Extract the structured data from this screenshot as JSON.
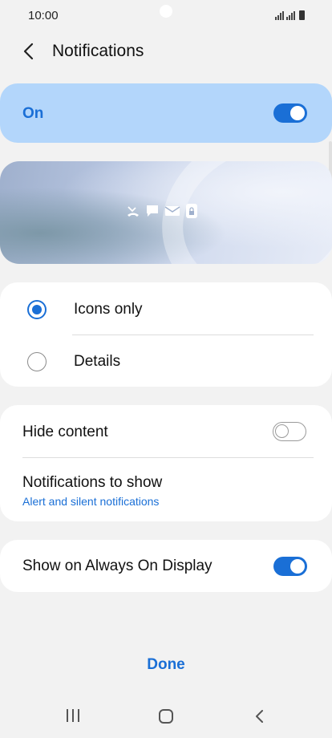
{
  "status_bar": {
    "time": "10:00"
  },
  "header": {
    "title": "Notifications"
  },
  "master": {
    "label": "On",
    "enabled": true
  },
  "preview": {
    "icons": [
      "missed-call-icon",
      "message-icon",
      "email-icon",
      "lock-icon"
    ]
  },
  "style_options": {
    "items": [
      {
        "label": "Icons only",
        "selected": true
      },
      {
        "label": "Details",
        "selected": false
      }
    ]
  },
  "content_card": {
    "hide_content_label": "Hide content",
    "hide_content_enabled": false,
    "notifications_to_show_label": "Notifications to show",
    "notifications_to_show_value": "Alert and silent notifications"
  },
  "aod_card": {
    "label": "Show on Always On Display",
    "enabled": true
  },
  "footer": {
    "done_label": "Done"
  },
  "colors": {
    "accent": "#1a6fd6",
    "master_bg": "#b3d6fb",
    "page_bg": "#f2f2f2"
  }
}
